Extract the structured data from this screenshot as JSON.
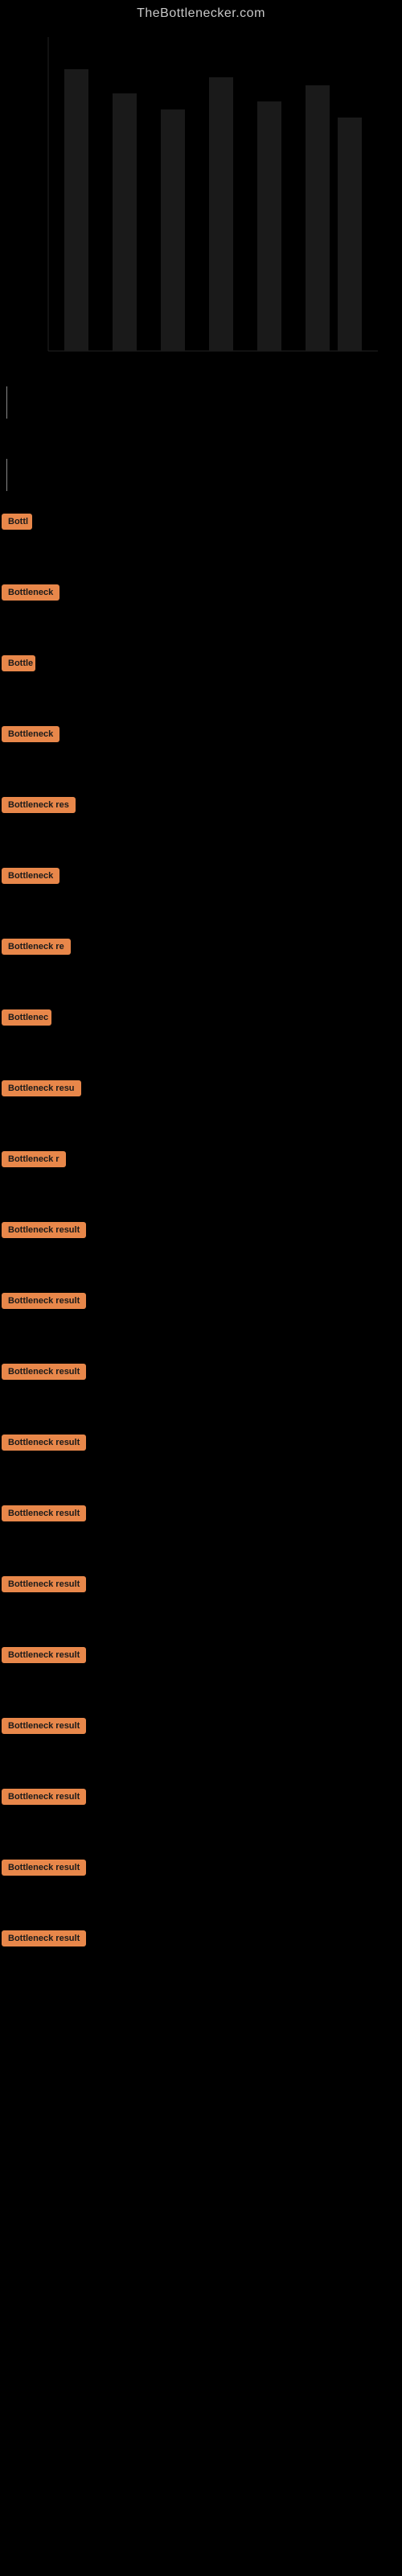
{
  "site": {
    "title": "TheBottlenecker.com"
  },
  "chart": {
    "description": "Bottleneck analysis chart",
    "background": "#000000"
  },
  "results": [
    {
      "id": 1,
      "label": "Bottl",
      "width": 38
    },
    {
      "id": 2,
      "label": "Bottleneck",
      "width": 72
    },
    {
      "id": 3,
      "label": "Bottle",
      "width": 42
    },
    {
      "id": 4,
      "label": "Bottleneck",
      "width": 72
    },
    {
      "id": 5,
      "label": "Bottleneck res",
      "width": 100
    },
    {
      "id": 6,
      "label": "Bottleneck",
      "width": 72
    },
    {
      "id": 7,
      "label": "Bottleneck re",
      "width": 88
    },
    {
      "id": 8,
      "label": "Bottlenec",
      "width": 62
    },
    {
      "id": 9,
      "label": "Bottleneck resu",
      "width": 105
    },
    {
      "id": 10,
      "label": "Bottleneck r",
      "width": 82
    },
    {
      "id": 11,
      "label": "Bottleneck result",
      "width": 118
    },
    {
      "id": 12,
      "label": "Bottleneck result",
      "width": 118
    },
    {
      "id": 13,
      "label": "Bottleneck result",
      "width": 118
    },
    {
      "id": 14,
      "label": "Bottleneck result",
      "width": 118
    },
    {
      "id": 15,
      "label": "Bottleneck result",
      "width": 118
    },
    {
      "id": 16,
      "label": "Bottleneck result",
      "width": 118
    },
    {
      "id": 17,
      "label": "Bottleneck result",
      "width": 118
    },
    {
      "id": 18,
      "label": "Bottleneck result",
      "width": 118
    },
    {
      "id": 19,
      "label": "Bottleneck result",
      "width": 118
    },
    {
      "id": 20,
      "label": "Bottleneck result",
      "width": 118
    },
    {
      "id": 21,
      "label": "Bottleneck result",
      "width": 118
    }
  ],
  "colors": {
    "background": "#000000",
    "badge_bg": "#e8874a",
    "badge_text": "#1a1a1a",
    "title_text": "#c8c8c8"
  }
}
